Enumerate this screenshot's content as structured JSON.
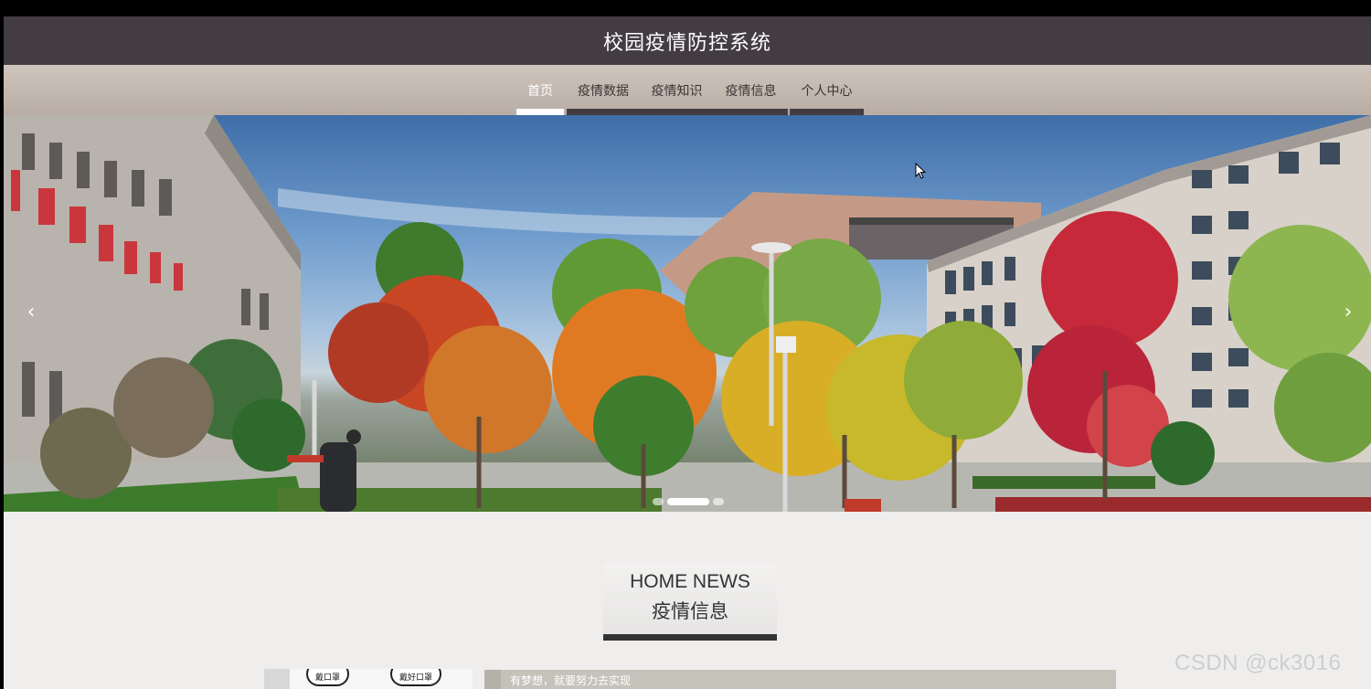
{
  "header": {
    "title": "校园疫情防控系统"
  },
  "nav": {
    "items": [
      {
        "label": "首页",
        "active": true
      },
      {
        "label": "疫情数据",
        "active": false
      },
      {
        "label": "疫情知识",
        "active": false
      },
      {
        "label": "疫情信息",
        "active": false
      },
      {
        "label": "个人中心",
        "active": false
      }
    ]
  },
  "banner": {
    "prev_icon": "chevron-left-icon",
    "next_icon": "chevron-right-icon",
    "prev_glyph": "‹",
    "next_glyph": "›",
    "slide_count": 3,
    "active_slide": 2
  },
  "news": {
    "heading_en": "HOME NEWS",
    "heading_zh": "疫情信息",
    "thumb_text_1": "戴口罩",
    "thumb_text_2": "戴好口罩",
    "item_title": "有梦想，就要努力去实现"
  },
  "watermark": "CSDN @ck3016",
  "colors": {
    "header_bg": "#433c42",
    "nav_bg": "#c3b8b0",
    "page_bg": "#efeeed"
  }
}
